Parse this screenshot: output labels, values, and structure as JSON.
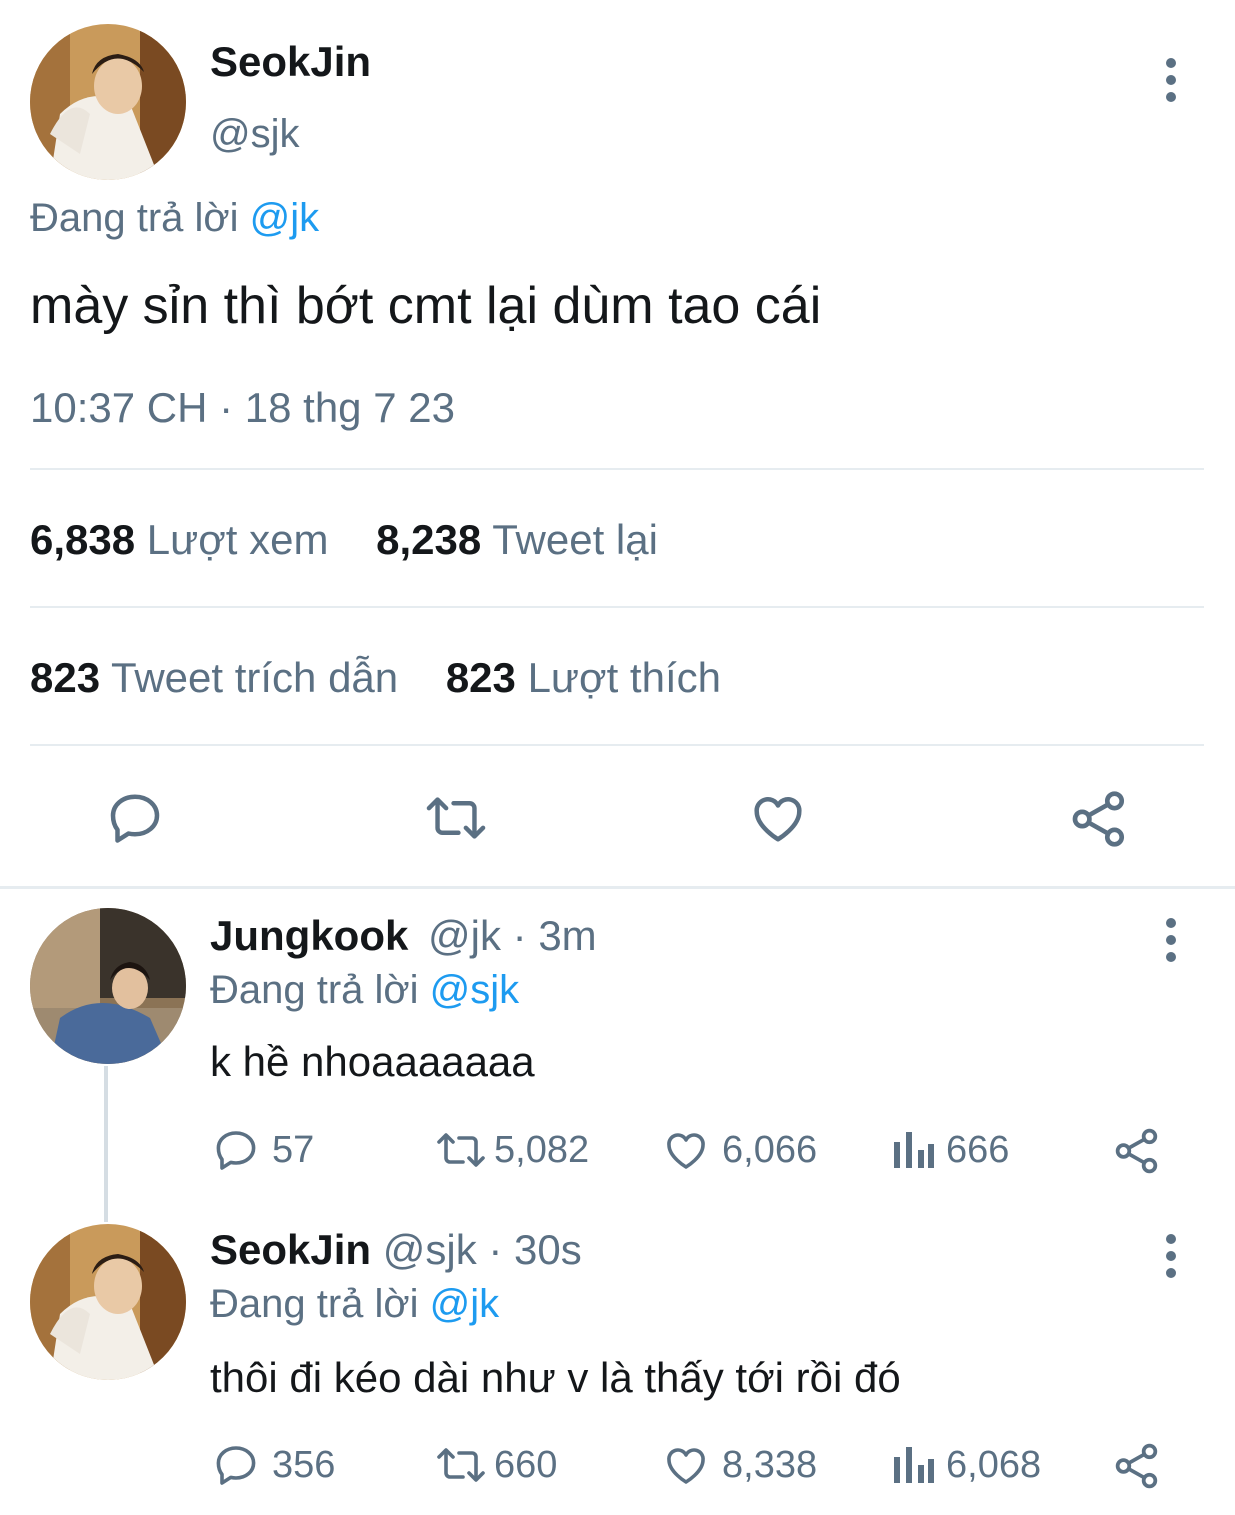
{
  "main_tweet": {
    "author_name": "SeokJin",
    "author_handle": "@sjk",
    "reply_prefix": "Đang trả lời",
    "reply_to": "@jk",
    "text": "mày sỉn thì bớt cmt lại dùm tao cái",
    "timestamp": "10:37 CH · 18 thg 7 23",
    "stats": {
      "views_count": "6,838",
      "views_label": "Lượt xem",
      "retweets_count": "8,238",
      "retweets_label": "Tweet lại",
      "quotes_count": "823",
      "quotes_label": "Tweet trích dẫn",
      "likes_count": "823",
      "likes_label": "Lượt thích"
    },
    "actions": [
      "reply-icon",
      "retweet-icon",
      "like-icon",
      "share-icon"
    ]
  },
  "replies": [
    {
      "author_name": "Jungkook",
      "author_handle": "@jk",
      "time": "· 3m",
      "reply_prefix": "Đang trả lời",
      "reply_to": "@sjk",
      "text": "k hề nhoaaaaaaa",
      "replies": "57",
      "retweets": "5,082",
      "likes": "6,066",
      "views": "666"
    },
    {
      "author_name": "SeokJin",
      "author_handle": "@sjk",
      "time": "· 30s",
      "reply_prefix": "Đang trả lời",
      "reply_to": "@jk",
      "text": "thôi đi kéo dài như v là thấy tới rồi đó",
      "replies": "356",
      "retweets": "660",
      "likes": "8,338",
      "views": "6,068"
    }
  ],
  "colors": {
    "link": "#1d9bf0",
    "secondary": "#5b7083",
    "divider": "#e6ecf0"
  }
}
